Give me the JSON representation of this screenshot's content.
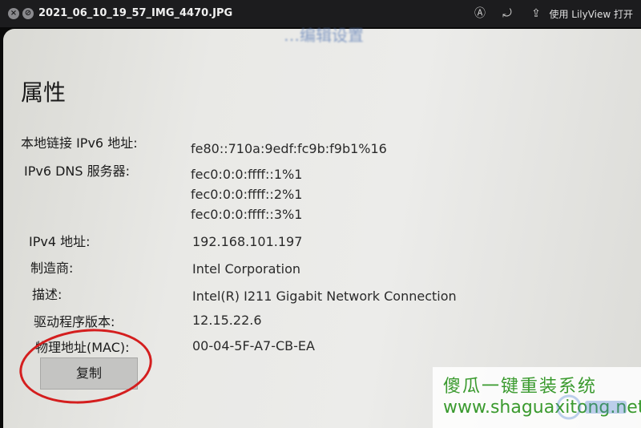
{
  "window": {
    "title": "2021_06_10_19_57_IMG_4470.JPG",
    "open_with": "使用 LilyView 打开",
    "icons": {
      "close": "close-icon",
      "block": "block-icon",
      "markup": "markup-icon",
      "rotate": "rotate-icon",
      "share": "share-icon"
    }
  },
  "dialog": {
    "blurred_top_text": "…编辑设置",
    "heading": "属性",
    "rows": [
      {
        "label": "本地链接 IPv6 地址:",
        "values": [
          "fe80::710a:9edf:fc9b:f9b1%16"
        ]
      },
      {
        "label": "IPv6 DNS 服务器:",
        "values": [
          "fec0:0:0:ffff::1%1",
          "fec0:0:0:ffff::2%1",
          "fec0:0:0:ffff::3%1"
        ]
      },
      {
        "label": "IPv4 地址:",
        "values": [
          "192.168.101.197"
        ]
      },
      {
        "label": "制造商:",
        "values": [
          "Intel Corporation"
        ]
      },
      {
        "label": "描述:",
        "values": [
          "Intel(R) I211 Gigabit Network Connection"
        ]
      },
      {
        "label": "驱动程序版本:",
        "values": [
          "12.15.22.6"
        ]
      },
      {
        "label": "物理地址(MAC):",
        "values": [
          "00-04-5F-A7-CB-EA"
        ]
      }
    ],
    "copy_button": "复制"
  },
  "watermark": {
    "cn": "傻瓜一键重装系统",
    "url": "www.shaguaxitong.net",
    "color": "#3a9a2e"
  },
  "annotation": {
    "color": "#d41e1e"
  }
}
